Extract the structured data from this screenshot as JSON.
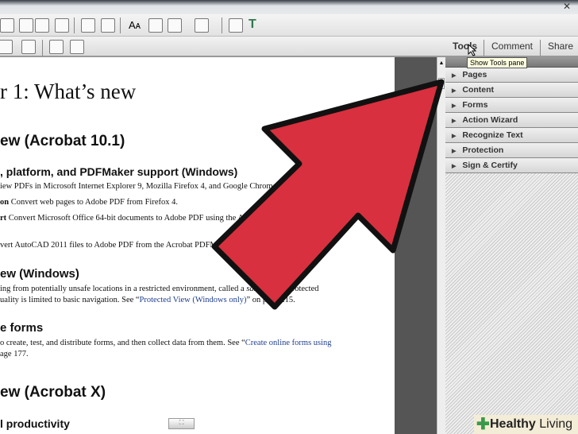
{
  "window": {
    "close_icon": "close-icon"
  },
  "nav": {
    "tools": "Tools",
    "comment": "Comment",
    "share": "Share"
  },
  "tooltip": "Show Tools pane",
  "document": {
    "title": "r 1: What’s new",
    "h_acrobat101": "ew (Acrobat 10.1)",
    "h_platform": ", platform, and PDFMaker support (Windows)",
    "p1": "iew PDFs in Microsoft Internet Explorer 9, Mozilla Firefox 4, and Google Chrome.",
    "p2_bold": "on",
    "p2": " Convert web pages to Adobe PDF from Firefox 4.",
    "p3_bold": "rt",
    "p3": " Convert Microsoft Office 64-bit documents to Adobe PDF using the Acrobat PDFMaker",
    "p4": "vert AutoCAD 2011 files to Adobe PDF from the Acrobat PDFMaker toolbar.",
    "h_protected": "ew (Windows)",
    "p5a": "ing from potentially unsafe locations in a restricted environment, called a ",
    "p5_em": "sandbox",
    "p5b": ". In Protected",
    "p6a": "uality is limited to basic navigation. See “",
    "p6_link": "Protected View (Windows only)",
    "p6b": "” on page 215.",
    "h_forms": "e forms",
    "p7a": "o create, test, and distribute forms, and then collect data from them. See “",
    "p7_link": "Create online forms using",
    "p8": "age 177.",
    "h_acrobatx": "ew (Acrobat X)",
    "h_productivity": "l productivity"
  },
  "tools_pane": {
    "sections": [
      "Pages",
      "Content",
      "Forms",
      "Action Wizard",
      "Recognize Text",
      "Protection",
      "Sign & Certify"
    ]
  },
  "watermark": {
    "bold": "Healthy",
    "light": " Living"
  },
  "colors": {
    "arrow": "#d8303e",
    "link": "#1f3f8f"
  }
}
